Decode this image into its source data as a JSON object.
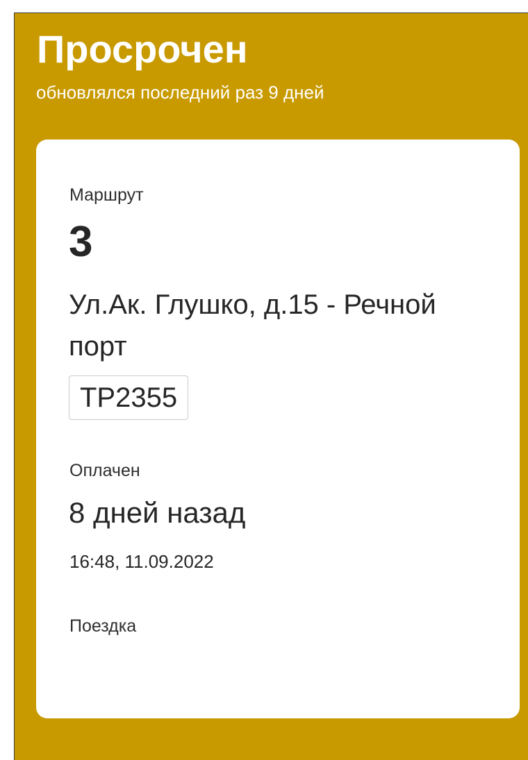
{
  "status": {
    "title": "Просрочен",
    "subtitle": "обновлялся последний раз 9 дней"
  },
  "ticket": {
    "route_label": "Маршрут",
    "route_number": "3",
    "route_name": "Ул.Ак. Глушко, д.15 - Речной порт",
    "vehicle_number": "ТР2355",
    "paid_label": "Оплачен",
    "paid_ago": "8 дней назад",
    "paid_time": "16:48, 11.09.2022",
    "trip_label": "Поездка"
  },
  "colors": {
    "background": "#c89a00",
    "card": "#ffffff",
    "text": "#262626"
  }
}
